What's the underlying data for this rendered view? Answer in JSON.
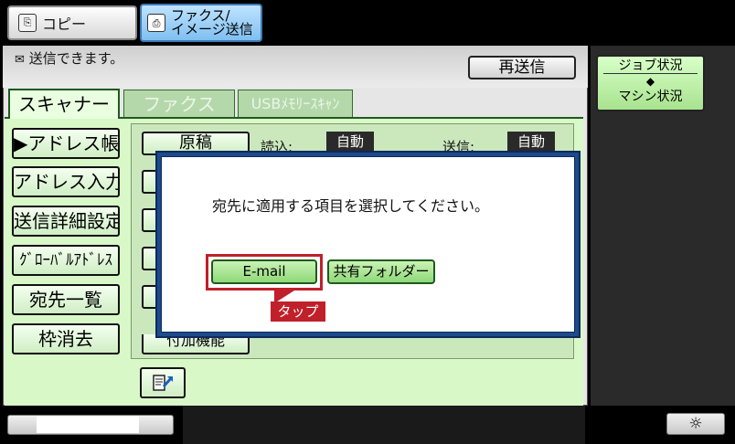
{
  "mode_tabs": {
    "copy_label": "コピー",
    "fax_image_label_line1": "ファクス/",
    "fax_image_label_line2": "イメージ送信"
  },
  "status": {
    "message": "送信できます。",
    "resend_label": "再送信"
  },
  "tabs": [
    "スキャナー",
    "ファクス",
    "USBﾒﾓﾘｰｽｷｬﾝ"
  ],
  "left_buttons": [
    "▶アドレス帳",
    "アドレス入力",
    "送信詳細設定",
    "ｸﾞﾛｰﾊﾞﾙｱﾄﾞﾚｽ",
    "宛先一覧",
    "枠消去"
  ],
  "original": {
    "button_label": "原稿",
    "read_label": "読込:",
    "read_value": "自動",
    "send_label": "送信:",
    "send_value": "自動"
  },
  "extra_button_label": "付加機能",
  "dialog": {
    "message": "宛先に適用する項目を選択してください。",
    "email_label": "E-mail",
    "shared_folder_label": "共有フォルダー",
    "tap_label": "タップ"
  },
  "job_status": {
    "line1": "ジョブ状況",
    "arrow": "◆",
    "line2": "マシン状況"
  },
  "brightness_icon": "☼",
  "colors": {
    "accent_red": "#c0202a",
    "panel_green": "#d9f8c8",
    "dialog_border": "#1d4a8a"
  }
}
